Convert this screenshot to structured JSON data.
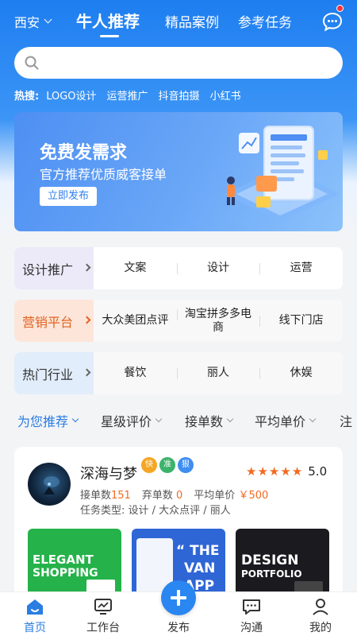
{
  "header": {
    "city": "西安",
    "tabs": [
      {
        "label": "牛人推荐",
        "active": true
      },
      {
        "label": "精品案例",
        "active": false
      },
      {
        "label": "参考任务",
        "active": false
      }
    ]
  },
  "search": {
    "placeholder": ""
  },
  "hot_search": {
    "label": "热搜:",
    "items": [
      "LOGO设计",
      "运营推广",
      "抖音拍摄",
      "小红书"
    ]
  },
  "banner": {
    "title": "免费发需求",
    "subtitle": "官方推荐优质威客接单",
    "button": "立即发布"
  },
  "categories": [
    {
      "title": "设计推广",
      "items": [
        "文案",
        "设计",
        "运营"
      ]
    },
    {
      "title": "营销平台",
      "items": [
        "大众美团点评",
        "淘宝拼多多电商",
        "线下门店"
      ]
    },
    {
      "title": "热门行业",
      "items": [
        "餐饮",
        "丽人",
        "休娱"
      ]
    }
  ],
  "filters": [
    "为您推荐",
    "星级评价",
    "接单数",
    "平均单价",
    "注"
  ],
  "card": {
    "name": "深海与梦",
    "badges": [
      "快",
      "准",
      "狠"
    ],
    "rating": "5.0",
    "stars": 5,
    "accepted_label": "接单数",
    "accepted": "151",
    "abandoned_label": "弃单数",
    "abandoned": "0",
    "price_label": "平均单价",
    "price": "￥500",
    "types": "任务类型: 设计 / 大众点评 / 丽人",
    "thumbs": [
      {
        "line1": "ELEGANT",
        "line2": "SHOPPING"
      },
      {
        "line1": "“ THE",
        "line2": "VAN",
        "line3": "APP"
      },
      {
        "line1": "DESIGN",
        "line2": "PORTFOLIO"
      }
    ]
  },
  "tabbar": [
    "首页",
    "工作台",
    "发布",
    "沟通",
    "我的"
  ],
  "colors": {
    "brand": "#2a7de1",
    "accent": "#f26a21"
  }
}
